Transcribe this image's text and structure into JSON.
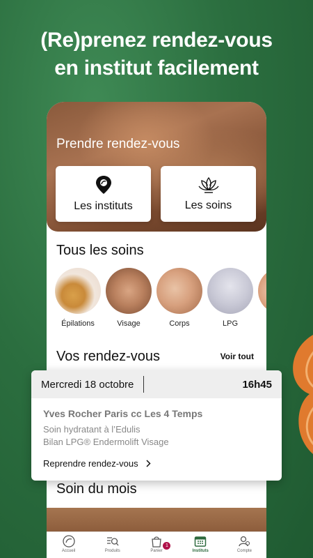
{
  "headline": {
    "line1": "(Re)prenez rendez-vous",
    "line2": "en institut facilement"
  },
  "hero": {
    "title": "Prendre rendez-vous",
    "cards": [
      {
        "label": "Les instituts",
        "icon": "location-pin-icon"
      },
      {
        "label": "Les soins",
        "icon": "lotus-icon"
      }
    ]
  },
  "soins": {
    "title": "Tous les soins",
    "items": [
      {
        "label": "Épilations"
      },
      {
        "label": "Visage"
      },
      {
        "label": "Corps"
      },
      {
        "label": "LPG"
      }
    ]
  },
  "rdv": {
    "title": "Vos rendez-vous",
    "see_all": "Voir tout"
  },
  "appointment": {
    "date": "Mercredi 18 octobre",
    "time": "16h45",
    "institute": "Yves Rocher Paris cc Les 4 Temps",
    "services": [
      "Soin hydratant à l’Edulis",
      "Bilan LPG® Endermolift Visage"
    ],
    "rebook": "Reprendre rendez-vous"
  },
  "month": {
    "title": "Soin du mois"
  },
  "tabbar": {
    "badge_count": "1",
    "tabs": [
      {
        "label": "Accueil",
        "icon": "home-logo-icon"
      },
      {
        "label": "Produits",
        "icon": "products-search-icon"
      },
      {
        "label": "Panier",
        "icon": "cart-bag-icon"
      },
      {
        "label": "Instituts",
        "icon": "calendar-icon",
        "active": true
      },
      {
        "label": "Compte",
        "icon": "account-icon"
      }
    ]
  },
  "colors": {
    "brand_green": "#2b6e3f",
    "badge": "#b0124a"
  }
}
